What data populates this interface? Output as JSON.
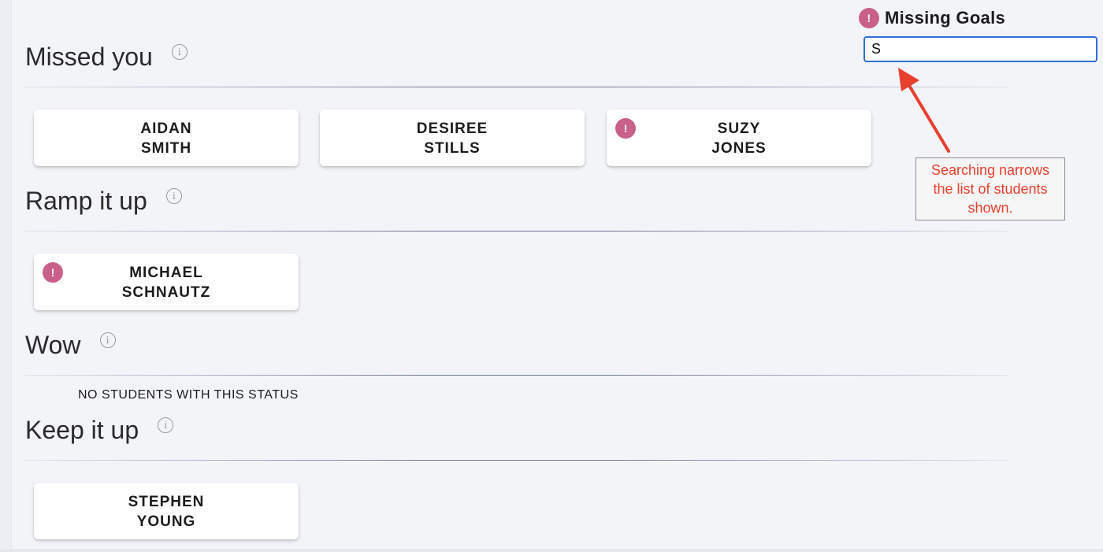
{
  "filter": {
    "label": "Missing Goals",
    "search_value": "S"
  },
  "callout": {
    "text": "Searching narrows the list of students shown."
  },
  "colors": {
    "alert": "#c9608a",
    "input_focus_border": "#2f6fd6",
    "callout": "#e8402e",
    "page_bg": "#f3f4f8"
  },
  "sections": [
    {
      "title": "Missed you",
      "students": [
        {
          "first": "AIDAN",
          "last": "SMITH",
          "missing_goals": false
        },
        {
          "first": "DESIREE",
          "last": "STILLS",
          "missing_goals": false
        },
        {
          "first": "SUZY",
          "last": "JONES",
          "missing_goals": true
        }
      ]
    },
    {
      "title": "Ramp it up",
      "students": [
        {
          "first": "MICHAEL",
          "last": "SCHNAUTZ",
          "missing_goals": true
        }
      ]
    },
    {
      "title": "Wow",
      "students": [],
      "empty_text": "NO STUDENTS WITH THIS STATUS"
    },
    {
      "title": "Keep it up",
      "students": [
        {
          "first": "STEPHEN",
          "last": "YOUNG",
          "missing_goals": false
        }
      ]
    }
  ]
}
